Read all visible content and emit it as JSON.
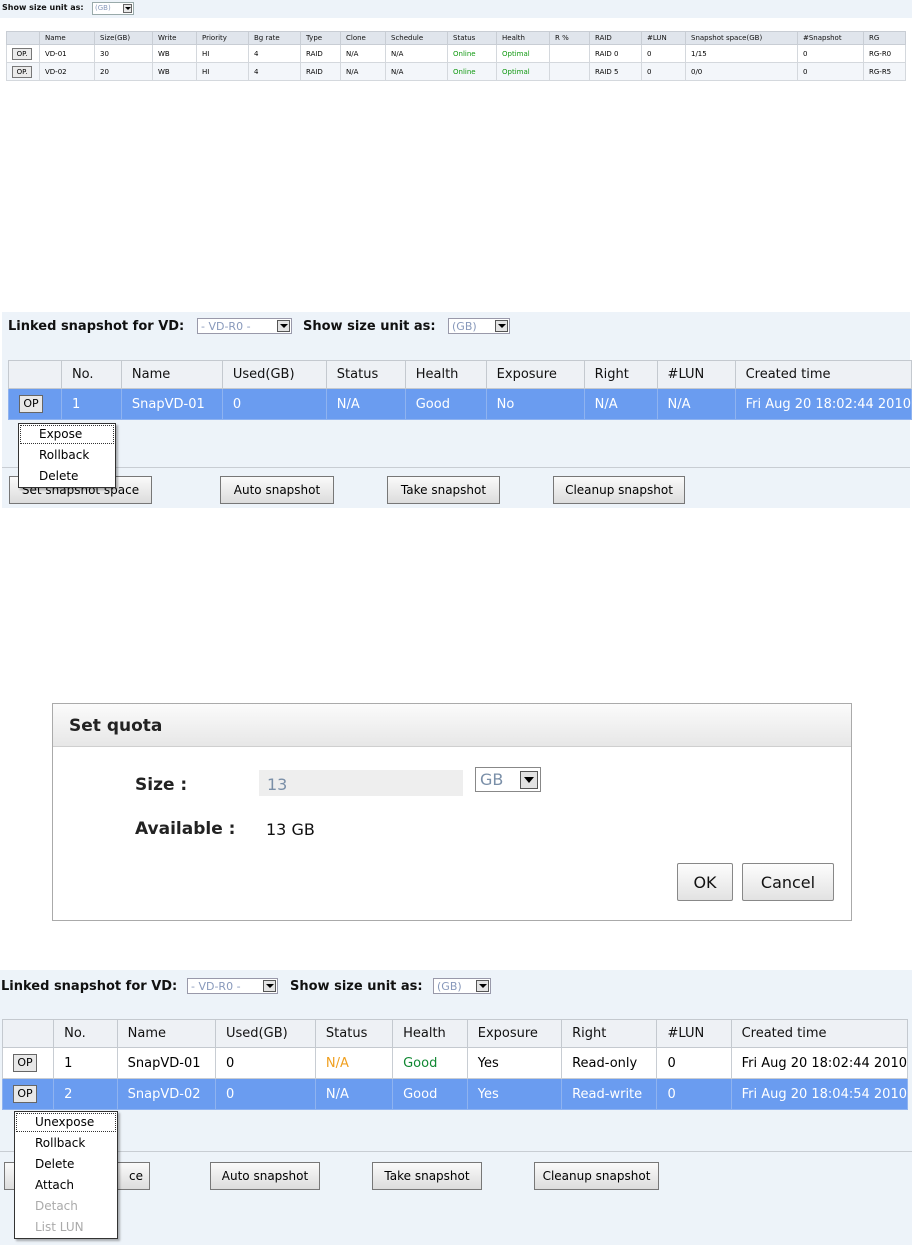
{
  "panel1": {
    "unit_label": "Show size unit as:",
    "unit_value": "(GB)",
    "columns": [
      "",
      "Name",
      "Size(GB)",
      "Write",
      "Priority",
      "Bg rate",
      "Type",
      "Clone",
      "Schedule",
      "Status",
      "Health",
      "R %",
      "RAID",
      "#LUN",
      "Snapshot space(GB)",
      "#Snapshot",
      "RG"
    ],
    "rows": [
      {
        "op": "OP.",
        "name": "VD-01",
        "size": "30",
        "write": "WB",
        "priority": "HI",
        "bg_rate": "4",
        "type": "RAID",
        "clone": "N/A",
        "schedule": "N/A",
        "status": "Online",
        "health": "Optimal",
        "r_pct": "",
        "raid": "RAID 0",
        "lun": "0",
        "snap_space": "1/15",
        "snap_count": "0",
        "rg": "RG-R0"
      },
      {
        "op": "OP.",
        "name": "VD-02",
        "size": "20",
        "write": "WB",
        "priority": "HI",
        "bg_rate": "4",
        "type": "RAID",
        "clone": "N/A",
        "schedule": "N/A",
        "status": "Online",
        "health": "Optimal",
        "r_pct": "",
        "raid": "RAID 5",
        "lun": "0",
        "snap_space": "0/0",
        "snap_count": "0",
        "rg": "RG-R5"
      }
    ]
  },
  "panel2": {
    "vd_label": "Linked snapshot for VD:",
    "vd_value": "- VD-R0 -",
    "unit_label": "Show size unit as:",
    "unit_value": "(GB)",
    "columns": [
      "",
      "No.",
      "Name",
      "Used(GB)",
      "Status",
      "Health",
      "Exposure",
      "Right",
      "#LUN",
      "Created time"
    ],
    "rows": [
      {
        "op": "OP",
        "no": "1",
        "name": "SnapVD-01",
        "used": "0",
        "status": "N/A",
        "health": "Good",
        "exposure": "No",
        "right": "N/A",
        "lun": "N/A",
        "created": "Fri Aug 20 18:02:44 2010"
      }
    ],
    "menu": [
      "Expose",
      "Rollback",
      "Delete"
    ],
    "buttons": {
      "set_space": "Set snapshot space",
      "auto": "Auto snapshot",
      "take": "Take snapshot",
      "cleanup": "Cleanup snapshot"
    }
  },
  "dialog": {
    "title": "Set quota",
    "size_label": "Size :",
    "size_value": "13",
    "unit": "GB",
    "available_label": "Available :",
    "available_value": "13 GB",
    "ok": "OK",
    "cancel": "Cancel"
  },
  "panel4": {
    "vd_label": "Linked snapshot for VD:",
    "vd_value": "- VD-R0 -",
    "unit_label": "Show size unit as:",
    "unit_value": "(GB)",
    "columns": [
      "",
      "No.",
      "Name",
      "Used(GB)",
      "Status",
      "Health",
      "Exposure",
      "Right",
      "#LUN",
      "Created time"
    ],
    "rows": [
      {
        "op": "OP",
        "no": "1",
        "name": "SnapVD-01",
        "used": "0",
        "status": "N/A",
        "health": "Good",
        "exposure": "Yes",
        "right": "Read-only",
        "lun": "0",
        "created": "Fri Aug 20 18:02:44 2010"
      },
      {
        "op": "OP",
        "no": "2",
        "name": "SnapVD-02",
        "used": "0",
        "status": "N/A",
        "health": "Good",
        "exposure": "Yes",
        "right": "Read-write",
        "lun": "0",
        "created": "Fri Aug 20 18:04:54 2010"
      }
    ],
    "menu": [
      {
        "label": "Unexpose",
        "enabled": true
      },
      {
        "label": "Rollback",
        "enabled": true
      },
      {
        "label": "Delete",
        "enabled": true
      },
      {
        "label": "Attach",
        "enabled": true
      },
      {
        "label": "Detach",
        "enabled": false
      },
      {
        "label": "List LUN",
        "enabled": false
      }
    ],
    "buttons": {
      "set_space_tail": "ce",
      "auto": "Auto snapshot",
      "take": "Take snapshot",
      "cleanup": "Cleanup snapshot"
    }
  },
  "colors": {
    "selected_row": "#6a9cf0",
    "status_na": "#f0a020",
    "health_good": "#118833",
    "panel_bg": "#edf3f9"
  }
}
